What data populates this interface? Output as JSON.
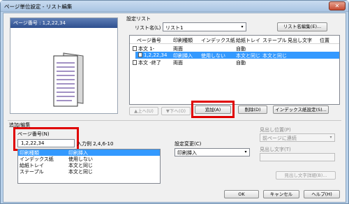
{
  "window": {
    "title": "ページ単位設定 - リスト編集"
  },
  "preview": {
    "page_number_label": "ページ番号 : 1,2,22,34"
  },
  "setting_list": {
    "label": "設定リスト",
    "list_name_label": "リスト名(L)",
    "list_name_value": "リスト1",
    "list_name_edit_button": "リスト名編集(E)...",
    "columns": [
      "ページ番号",
      "印刷種類",
      "インデックス紙",
      "給紙トレイ",
      "ステープル",
      "見出し文字",
      "位置"
    ],
    "rows": [
      {
        "page": "本文 1-",
        "print": "両面",
        "index": "",
        "tray": "自動",
        "staple": "",
        "heading": "",
        "pos": ""
      },
      {
        "page": "1,2,22,34",
        "print": "印刷挿入",
        "index": "使用しない",
        "tray": "本文と同じ",
        "staple": "本文と同じ",
        "heading": "",
        "pos": ""
      },
      {
        "page": "本文 -終了",
        "print": "両面",
        "index": "",
        "tray": "自動",
        "staple": "",
        "heading": "",
        "pos": ""
      }
    ],
    "up_button": "▲上へ(U)",
    "down_button": "▼下へ(O)",
    "add_button": "追加(A)",
    "delete_button": "削除(D)",
    "index_button": "インデックス紙設定(S)..."
  },
  "add_edit": {
    "label": "追加/編集",
    "page_number_label": "ページ番号(N)",
    "page_number_value": "1,2,22,34",
    "example_text": "入力例 2,4,6-10",
    "summary": [
      {
        "key": "印刷種類",
        "value": "印刷挿入"
      },
      {
        "key": "インデックス紙",
        "value": "使用しない"
      },
      {
        "key": "給紙トレイ",
        "value": "本文と同じ"
      },
      {
        "key": "ステープル",
        "value": "本文と同じ"
      }
    ],
    "setting_change_label": "設定変更(C)",
    "setting_change_value": "印刷挿入",
    "heading_position_label": "見出し位置(P)",
    "heading_position_value": "前ページに連続",
    "heading_text_label": "見出し文字(T)",
    "heading_text_edit_button": "見出し文字詳細(B)..."
  },
  "footer": {
    "ok": "OK",
    "cancel": "キャンセル",
    "help": "ヘルプ(H)"
  },
  "colors": {
    "highlight": "#e00000",
    "selection": "#3399ff"
  }
}
